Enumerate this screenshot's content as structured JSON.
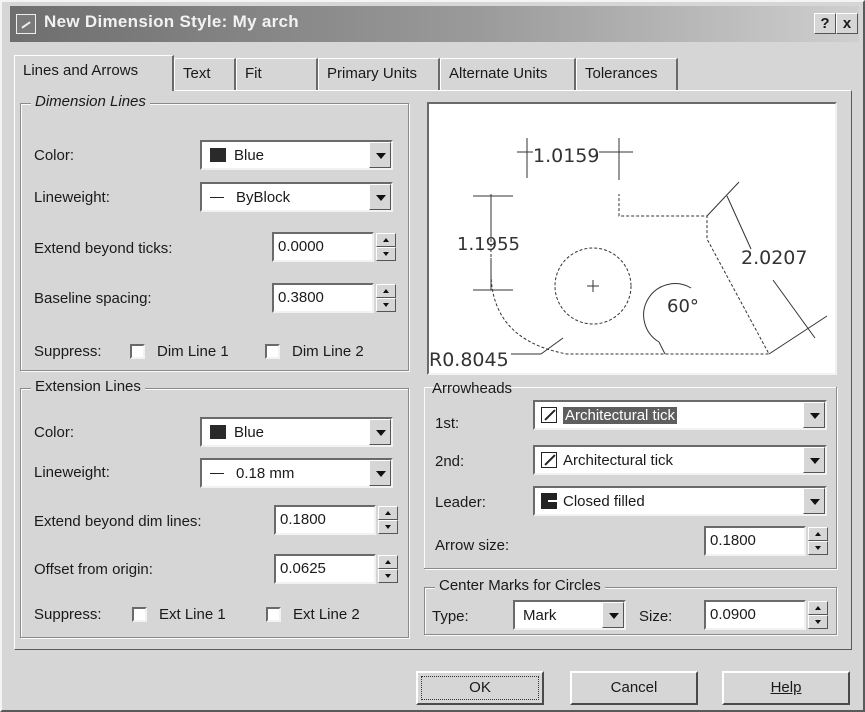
{
  "window": {
    "title": "New Dimension Style: My arch",
    "help_glyph": "?",
    "close_glyph": "x"
  },
  "tabs": [
    {
      "label": "Lines and Arrows",
      "active": true
    },
    {
      "label": "Text"
    },
    {
      "label": "Fit"
    },
    {
      "label": "Primary Units"
    },
    {
      "label": "Alternate Units"
    },
    {
      "label": "Tolerances"
    }
  ],
  "dimension_lines": {
    "title": "Dimension Lines",
    "color_label": "Color:",
    "color_value": "Blue",
    "lineweight_label": "Lineweight:",
    "lineweight_value": "ByBlock",
    "extend_label": "Extend beyond ticks:",
    "extend_value": "0.0000",
    "baseline_label": "Baseline spacing:",
    "baseline_value": "0.3800",
    "suppress_label": "Suppress:",
    "dim1_label": "Dim Line 1",
    "dim2_label": "Dim Line 2"
  },
  "extension_lines": {
    "title": "Extension Lines",
    "color_label": "Color:",
    "color_value": "Blue",
    "lineweight_label": "Lineweight:",
    "lineweight_value": "0.18 mm",
    "extend_label": "Extend beyond dim lines:",
    "extend_value": "0.1800",
    "offset_label": "Offset from origin:",
    "offset_value": "0.0625",
    "suppress_label": "Suppress:",
    "ext1_label": "Ext Line 1",
    "ext2_label": "Ext Line 2"
  },
  "preview": {
    "dim_top": "1.0159",
    "dim_left": "1.1955",
    "dim_diag": "2.0207",
    "angle": "60°",
    "radius": "R0.8045",
    "center_mark": "+"
  },
  "arrowheads": {
    "title": "Arrowheads",
    "first_label": "1st:",
    "first_value": "Architectural tick",
    "second_label": "2nd:",
    "second_value": "Architectural tick",
    "leader_label": "Leader:",
    "leader_value": "Closed filled",
    "size_label": "Arrow size:",
    "size_value": "0.1800"
  },
  "center_marks": {
    "title": "Center Marks for Circles",
    "type_label": "Type:",
    "type_value": "Mark",
    "size_label": "Size:",
    "size_value": "0.0900"
  },
  "buttons": {
    "ok": "OK",
    "cancel": "Cancel",
    "help": "Help"
  }
}
